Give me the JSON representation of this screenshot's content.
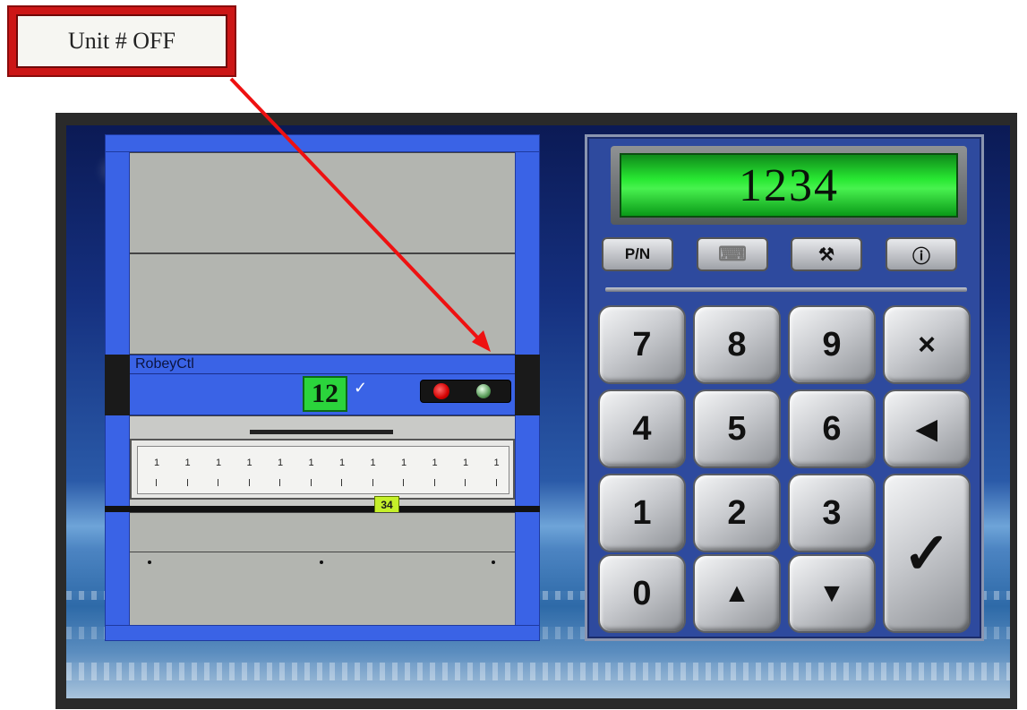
{
  "callout": {
    "text": "Unit # OFF"
  },
  "carousel": {
    "control_label": "RobeyCtl",
    "unit_number": "12",
    "check_mark": "✓",
    "shelf_number": "34",
    "divider_mark": "1"
  },
  "keypad": {
    "display_value": "1234",
    "function_buttons": {
      "part_number": "P/N",
      "keyboard": "⌨",
      "tools": "⚒",
      "info": "ⓘ"
    },
    "keys": {
      "k7": "7",
      "k8": "8",
      "k9": "9",
      "clear": "×",
      "k4": "4",
      "k5": "5",
      "k6": "6",
      "back": "◀",
      "k1": "1",
      "k2": "2",
      "k3": "3",
      "enter": "✓",
      "k0": "0",
      "up": "▲",
      "down": "▼"
    }
  },
  "colors": {
    "callout_border": "#cc1616",
    "rail_blue": "#3a63e6",
    "display_green": "#2be835",
    "shelf_tag": "#c5f02a",
    "arrow": "#ee1111"
  }
}
